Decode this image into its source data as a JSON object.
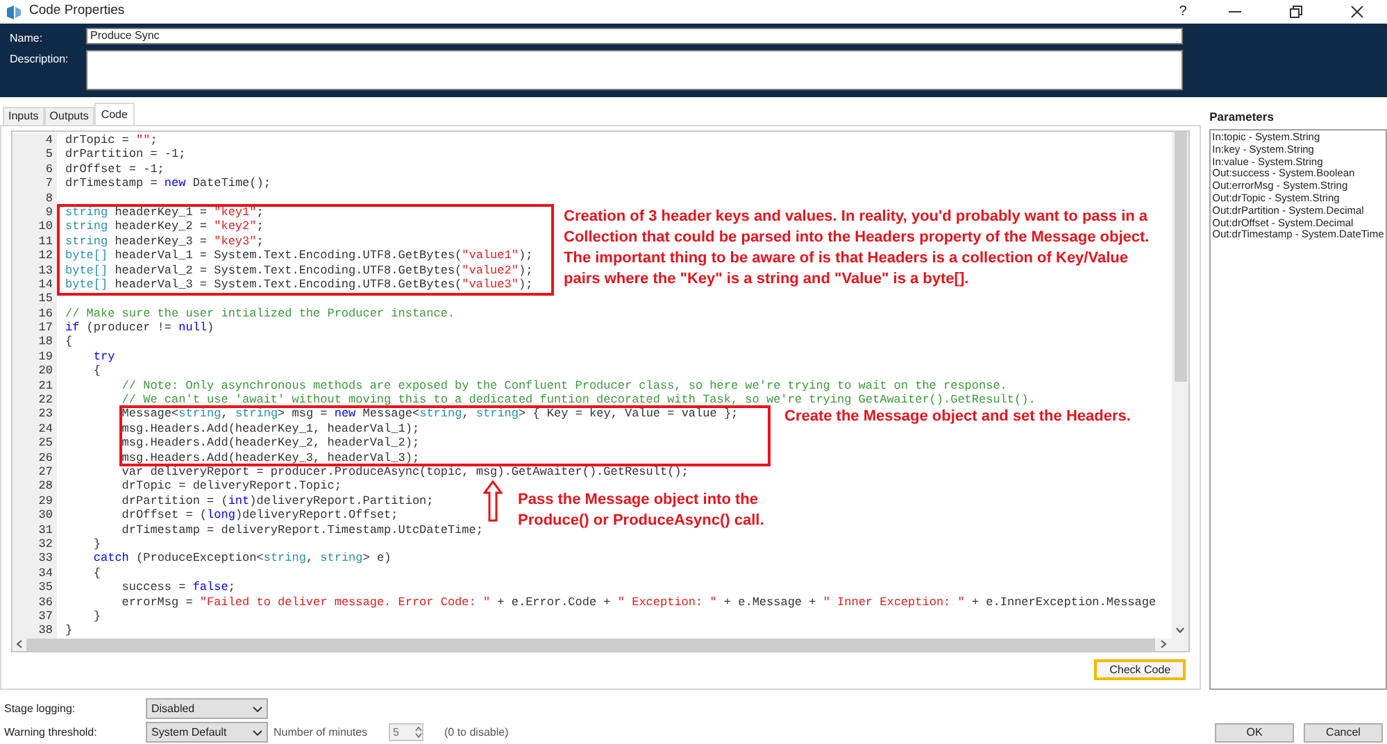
{
  "window": {
    "title": "Code Properties",
    "help": "?"
  },
  "name_field": {
    "label": "Name:",
    "value": "Produce Sync"
  },
  "description_field": {
    "label": "Description:"
  },
  "tabs": [
    {
      "label": "Inputs",
      "selected": false
    },
    {
      "label": "Outputs",
      "selected": false
    },
    {
      "label": "Code",
      "selected": true
    }
  ],
  "code_lines": [
    {
      "number": "4",
      "tokens": [
        {
          "kind": "plain",
          "text": "drTopic = "
        },
        {
          "kind": "string",
          "text": "\"\""
        },
        {
          "kind": "plain",
          "text": ";"
        }
      ]
    },
    {
      "number": "5",
      "tokens": [
        {
          "kind": "plain",
          "text": "drPartition = -1;"
        }
      ]
    },
    {
      "number": "6",
      "tokens": [
        {
          "kind": "plain",
          "text": "drOffset = -1;"
        }
      ]
    },
    {
      "number": "7",
      "tokens": [
        {
          "kind": "plain",
          "text": "drTimestamp = "
        },
        {
          "kind": "keyword",
          "text": "new"
        },
        {
          "kind": "plain",
          "text": " DateTime();"
        }
      ]
    },
    {
      "number": "8"
    },
    {
      "number": "9",
      "tokens": [
        {
          "kind": "type",
          "text": "string"
        },
        {
          "kind": "plain",
          "text": " headerKey_1 = "
        },
        {
          "kind": "string",
          "text": "\"key1\""
        },
        {
          "kind": "plain",
          "text": ";"
        }
      ]
    },
    {
      "number": "10",
      "tokens": [
        {
          "kind": "type",
          "text": "string"
        },
        {
          "kind": "plain",
          "text": " headerKey_2 = "
        },
        {
          "kind": "string",
          "text": "\"key2\""
        },
        {
          "kind": "plain",
          "text": ";"
        }
      ]
    },
    {
      "number": "11",
      "tokens": [
        {
          "kind": "type",
          "text": "string"
        },
        {
          "kind": "plain",
          "text": " headerKey_3 = "
        },
        {
          "kind": "string",
          "text": "\"key3\""
        },
        {
          "kind": "plain",
          "text": ";"
        }
      ]
    },
    {
      "number": "12",
      "tokens": [
        {
          "kind": "type",
          "text": "byte[]"
        },
        {
          "kind": "plain",
          "text": " headerVal_1 = System.Text.Encoding.UTF8.GetBytes("
        },
        {
          "kind": "string",
          "text": "\"value1\""
        },
        {
          "kind": "plain",
          "text": ");"
        }
      ]
    },
    {
      "number": "13",
      "tokens": [
        {
          "kind": "type",
          "text": "byte[]"
        },
        {
          "kind": "plain",
          "text": " headerVal_2 = System.Text.Encoding.UTF8.GetBytes("
        },
        {
          "kind": "string",
          "text": "\"value2\""
        },
        {
          "kind": "plain",
          "text": ");"
        }
      ]
    },
    {
      "number": "14",
      "tokens": [
        {
          "kind": "type",
          "text": "byte[]"
        },
        {
          "kind": "plain",
          "text": " headerVal_3 = System.Text.Encoding.UTF8.GetBytes("
        },
        {
          "kind": "string",
          "text": "\"value3\""
        },
        {
          "kind": "plain",
          "text": ");"
        }
      ]
    },
    {
      "number": "15"
    },
    {
      "number": "16",
      "tokens": [
        {
          "kind": "comment",
          "text": "// Make sure the user intialized the Producer instance."
        }
      ]
    },
    {
      "number": "17",
      "tokens": [
        {
          "kind": "keyword",
          "text": "if"
        },
        {
          "kind": "plain",
          "text": " (producer != "
        },
        {
          "kind": "keyword",
          "text": "null"
        },
        {
          "kind": "plain",
          "text": ")"
        }
      ]
    },
    {
      "number": "18",
      "tokens": [
        {
          "kind": "plain",
          "text": "{"
        }
      ]
    },
    {
      "number": "19",
      "tokens": [
        {
          "kind": "keyword",
          "text": "    try"
        }
      ]
    },
    {
      "number": "20",
      "tokens": [
        {
          "kind": "plain",
          "text": "    {"
        }
      ]
    },
    {
      "number": "21",
      "tokens": [
        {
          "kind": "comment",
          "text": "        // Note: Only asynchronous methods are exposed by the Confluent Producer class, so here we're trying to wait on the response."
        }
      ]
    },
    {
      "number": "22",
      "tokens": [
        {
          "kind": "comment",
          "text": "        // We can't use 'await' without moving this to a dedicated funtion decorated with Task, so we're trying GetAwaiter().GetResult()."
        }
      ]
    },
    {
      "number": "23",
      "tokens": [
        {
          "kind": "plain",
          "text": "        Message<"
        },
        {
          "kind": "type",
          "text": "string"
        },
        {
          "kind": "plain",
          "text": ", "
        },
        {
          "kind": "type",
          "text": "string"
        },
        {
          "kind": "plain",
          "text": "> msg = "
        },
        {
          "kind": "keyword",
          "text": "new"
        },
        {
          "kind": "plain",
          "text": " Message<"
        },
        {
          "kind": "type",
          "text": "string"
        },
        {
          "kind": "plain",
          "text": ", "
        },
        {
          "kind": "type",
          "text": "string"
        },
        {
          "kind": "plain",
          "text": "> { Key = key, Value = value };"
        }
      ]
    },
    {
      "number": "24",
      "tokens": [
        {
          "kind": "plain",
          "text": "        msg.Headers.Add(headerKey_1, headerVal_1);"
        }
      ]
    },
    {
      "number": "25",
      "tokens": [
        {
          "kind": "plain",
          "text": "        msg.Headers.Add(headerKey_2, headerVal_2);"
        }
      ]
    },
    {
      "number": "26",
      "tokens": [
        {
          "kind": "plain",
          "text": "        msg.Headers.Add(headerKey_3, headerVal_3);"
        }
      ]
    },
    {
      "number": "27",
      "tokens": [
        {
          "kind": "plain",
          "text": "        var deliveryReport = producer.ProduceAsync(topic, msg).GetAwaiter().GetResult();"
        }
      ]
    },
    {
      "number": "28",
      "tokens": [
        {
          "kind": "plain",
          "text": "        drTopic = deliveryReport.Topic;"
        }
      ]
    },
    {
      "number": "29",
      "tokens": [
        {
          "kind": "plain",
          "text": "        drPartition = ("
        },
        {
          "kind": "keyword",
          "text": "int"
        },
        {
          "kind": "plain",
          "text": ")deliveryReport.Partition;"
        }
      ]
    },
    {
      "number": "30",
      "tokens": [
        {
          "kind": "plain",
          "text": "        drOffset = ("
        },
        {
          "kind": "keyword",
          "text": "long"
        },
        {
          "kind": "plain",
          "text": ")deliveryReport.Offset;"
        }
      ]
    },
    {
      "number": "31",
      "tokens": [
        {
          "kind": "plain",
          "text": "        drTimestamp = deliveryReport.Timestamp.UtcDateTime;"
        }
      ]
    },
    {
      "number": "32",
      "tokens": [
        {
          "kind": "plain",
          "text": "    }"
        }
      ]
    },
    {
      "number": "33",
      "tokens": [
        {
          "kind": "keyword",
          "text": "    catch"
        },
        {
          "kind": "plain",
          "text": " (ProduceException<"
        },
        {
          "kind": "type",
          "text": "string"
        },
        {
          "kind": "plain",
          "text": ", "
        },
        {
          "kind": "type",
          "text": "string"
        },
        {
          "kind": "plain",
          "text": "> e)"
        }
      ]
    },
    {
      "number": "34",
      "tokens": [
        {
          "kind": "plain",
          "text": "    {"
        }
      ]
    },
    {
      "number": "35",
      "tokens": [
        {
          "kind": "plain",
          "text": "        success = "
        },
        {
          "kind": "keyword",
          "text": "false"
        },
        {
          "kind": "plain",
          "text": ";"
        }
      ]
    },
    {
      "number": "36",
      "tokens": [
        {
          "kind": "plain",
          "text": "        errorMsg = "
        },
        {
          "kind": "string",
          "text": "\"Failed to deliver message. Error Code: \""
        },
        {
          "kind": "plain",
          "text": " + e.Error.Code + "
        },
        {
          "kind": "string",
          "text": "\" Exception: \""
        },
        {
          "kind": "plain",
          "text": " + e.Message + "
        },
        {
          "kind": "string",
          "text": "\" Inner Exception: \""
        },
        {
          "kind": "plain",
          "text": " + e.InnerException.Message"
        }
      ]
    },
    {
      "number": "37",
      "tokens": [
        {
          "kind": "plain",
          "text": "    }"
        }
      ]
    },
    {
      "number": "38",
      "tokens": [
        {
          "kind": "plain",
          "text": "}"
        }
      ]
    }
  ],
  "annotations": [
    {
      "kind": "note",
      "text": "Creation of 3 header keys and values. In reality, you'd probably want to pass in a Collection that could be parsed into the Headers property of the Message object. The important thing to be aware of is that Headers is a collection of Key/Value pairs where the \"Key\" is a string and \"Value\" is a byte[]."
    },
    {
      "kind": "note",
      "text": "Create the Message object and set the Headers."
    },
    {
      "kind": "arrow_note",
      "text": "Pass the Message object into the Produce() or ProduceAsync() call."
    }
  ],
  "check_code_button": "Check Code",
  "parameters": {
    "title": "Parameters",
    "items": [
      "In:topic - System.String",
      "In:key - System.String",
      "In:value - System.String",
      "Out:success - System.Boolean",
      "Out:errorMsg - System.String",
      "Out:drTopic - System.String",
      "Out:drPartition - System.Decimal",
      "Out:drOffset - System.Decimal",
      "Out:drTimestamp - System.DateTime"
    ]
  },
  "stage_logging": {
    "label": "Stage logging:",
    "value": "Disabled"
  },
  "warning_threshold": {
    "label": "Warning threshold:",
    "value": "System Default",
    "minutes_label": "Number of minutes",
    "minutes_value": "5",
    "hint": "(0 to disable)"
  },
  "buttons": [
    "OK",
    "Cancel"
  ]
}
